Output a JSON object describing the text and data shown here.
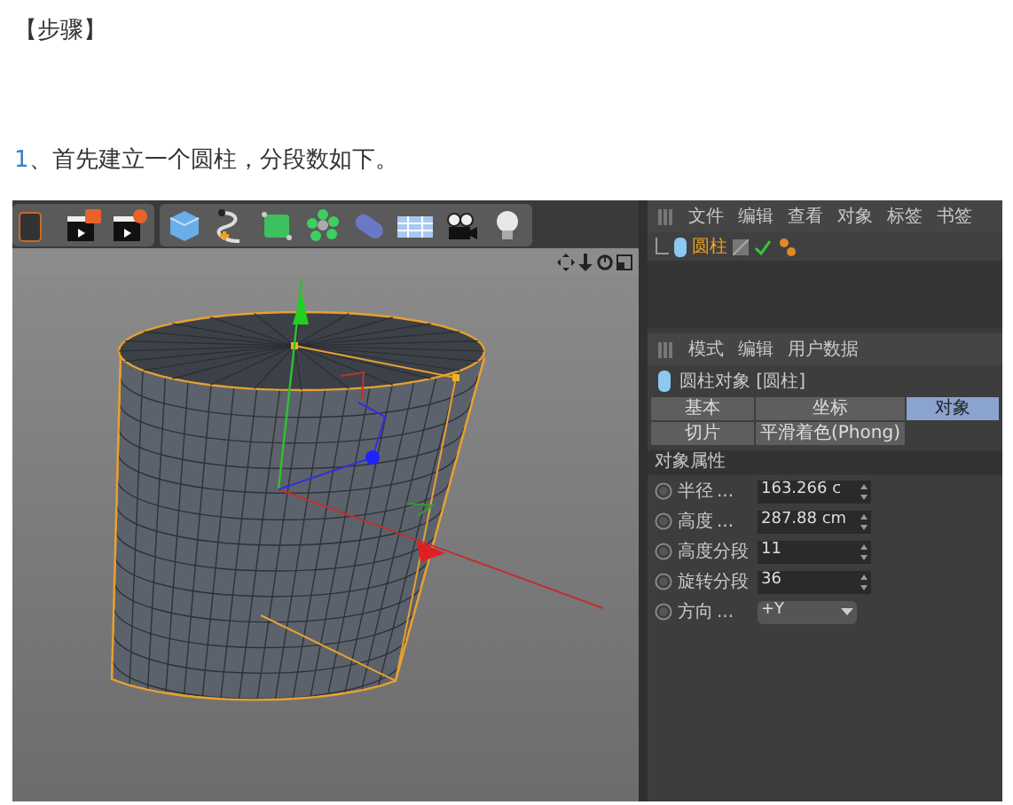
{
  "heading": "【步骤】",
  "step": {
    "number": "1",
    "text": "、首先建立一个圆柱，分段数如下。"
  },
  "object_manager": {
    "menu": [
      "文件",
      "编辑",
      "查看",
      "对象",
      "标签",
      "书签"
    ],
    "objects": [
      {
        "name": "圆柱",
        "selected": true,
        "enabled": true
      }
    ]
  },
  "attribute_manager": {
    "menu": [
      "模式",
      "编辑",
      "用户数据"
    ],
    "title": "圆柱对象 [圆柱]",
    "tabs": [
      {
        "label": "基本",
        "selected": false
      },
      {
        "label": "坐标",
        "selected": false
      },
      {
        "label": "对象",
        "selected": true
      },
      {
        "label": "切片",
        "selected": false
      },
      {
        "label": "平滑着色(Phong)",
        "selected": false
      }
    ],
    "section": "对象属性",
    "params": [
      {
        "label": "半径",
        "dots": "...",
        "value": "163.266 c",
        "kind": "number"
      },
      {
        "label": "高度",
        "dots": "...",
        "value": "287.88 cm",
        "kind": "number"
      },
      {
        "label": "高度分段",
        "value": "11",
        "kind": "number"
      },
      {
        "label": "旋转分段",
        "value": "36",
        "kind": "number"
      },
      {
        "label": "方向",
        "dots": "...",
        "value": "+Y",
        "kind": "dropdown"
      }
    ]
  }
}
